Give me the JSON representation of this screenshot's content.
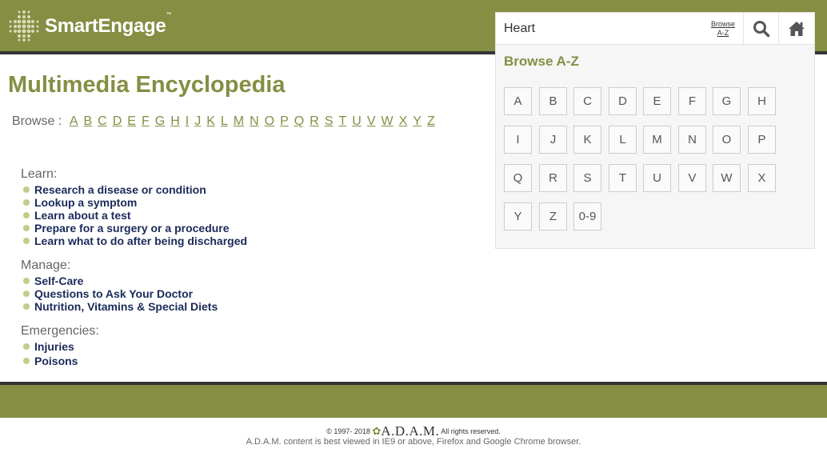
{
  "header": {
    "brand_name": "SmartEngage",
    "trademark": "™",
    "bg_color": "#858e43"
  },
  "page_title": "Multimedia Encyclopedia",
  "browse_bar": {
    "label": "Browse :",
    "letters": [
      "A",
      "B",
      "C",
      "D",
      "E",
      "F",
      "G",
      "H",
      "I",
      "J",
      "K",
      "L",
      "M",
      "N",
      "O",
      "P",
      "Q",
      "R",
      "S",
      "T",
      "U",
      "V",
      "W",
      "X",
      "Y",
      "Z"
    ]
  },
  "sections": {
    "learn": {
      "title": "Learn:",
      "items": [
        "Research a disease or condition",
        "Lookup a symptom",
        "Learn about a test",
        "Prepare for a surgery or a procedure",
        "Learn what to do after being discharged"
      ]
    },
    "manage": {
      "title": "Manage:",
      "items": [
        "Self-Care",
        "Questions to Ask Your Doctor",
        "Nutrition, Vitamins & Special Diets"
      ]
    },
    "emergencies": {
      "title": "Emergencies:",
      "items": [
        "Injuries",
        "Poisons"
      ]
    }
  },
  "search_panel": {
    "search_value": "Heart",
    "browse_az_link_line1": "Browse",
    "browse_az_link_line2": "A-Z",
    "search_icon": "search-icon",
    "home_icon": "home-icon",
    "title": "Browse A-Z",
    "keys": [
      "A",
      "B",
      "C",
      "D",
      "E",
      "F",
      "G",
      "H",
      "I",
      "J",
      "K",
      "L",
      "M",
      "N",
      "O",
      "P",
      "Q",
      "R",
      "S",
      "T",
      "U",
      "V",
      "W",
      "X",
      "Y",
      "Z",
      "0-9"
    ]
  },
  "footer": {
    "copyright_prefix": "© 1997- 2018",
    "adam_brand": "A.D.A.M.",
    "copyright_suffix": "All rights reserved.",
    "notice": "A.D.A.M. content is best viewed in IE9 or above, Firefox and Google Chrome browser."
  },
  "colors": {
    "accent": "#858e43",
    "link_dark": "#1a2a5a",
    "bullet": "#c4cd87"
  }
}
